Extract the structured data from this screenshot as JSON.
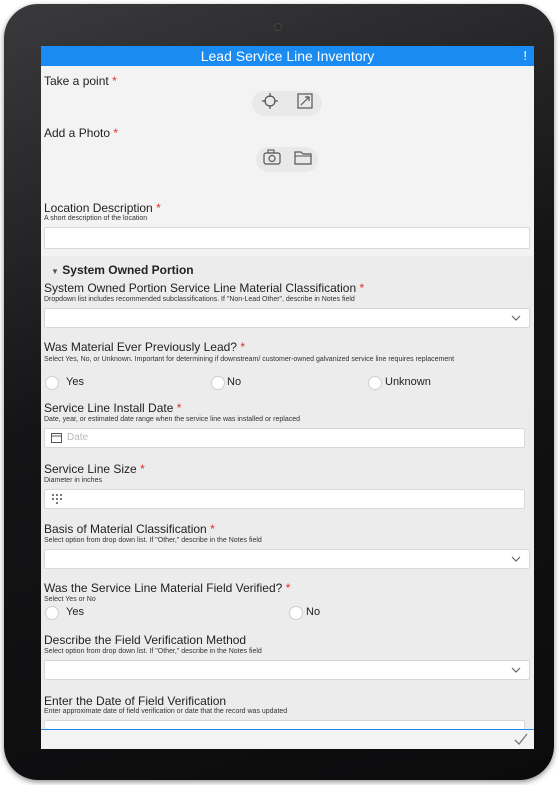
{
  "header": {
    "title": "Lead Service Line Inventory",
    "alert": "!"
  },
  "take_point": {
    "label": "Take a point",
    "required": "*"
  },
  "add_photo": {
    "label": "Add a Photo",
    "required": "*"
  },
  "location": {
    "label": "Location Description",
    "required": "*",
    "hint": "A short description of the location",
    "value": ""
  },
  "system_owned": {
    "title": "System Owned Portion",
    "material": {
      "label": "System Owned Portion Service Line Material Classification",
      "required": "*",
      "hint": "Dropdown list includes recommended subclassifications. If \"Non-Lead Other\", describe in Notes field",
      "value": ""
    },
    "previously_lead": {
      "label": "Was Material Ever Previously Lead?",
      "required": "*",
      "hint": "Select Yes, No, or Unknown. Important for determining if downstream/ customer-owned galvanized service line requires replacement",
      "options": [
        "Yes",
        "No",
        "Unknown"
      ]
    },
    "install_date": {
      "label": "Service Line Install Date",
      "required": "*",
      "hint": "Date, year, or estimated date range when the service line was installed or replaced",
      "placeholder": "Date"
    },
    "line_size": {
      "label": "Service Line Size",
      "required": "*",
      "hint": "Diameter in inches"
    },
    "basis": {
      "label": "Basis of Material Classification",
      "required": "*",
      "hint": "Select option from drop down list. If \"Other,\" describe in the Notes field",
      "value": ""
    },
    "field_verified": {
      "label": "Was the Service Line Material Field Verified?",
      "required": "*",
      "hint": "Select Yes or No",
      "options": [
        "Yes",
        "No"
      ]
    },
    "verification_method": {
      "label": "Describe the Field Verification Method",
      "hint": "Select option from drop down list. If \"Other,\" describe in the Notes field",
      "value": ""
    },
    "verification_date": {
      "label": "Enter the Date of Field Verification",
      "hint": "Enter approximate date of field verification or date that the record was updated"
    }
  },
  "footer": {
    "submit_icon": "check-icon"
  }
}
